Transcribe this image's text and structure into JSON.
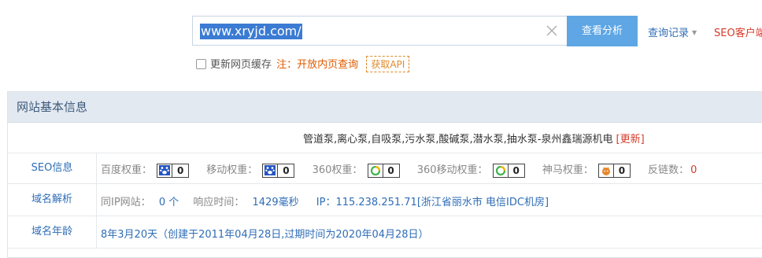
{
  "search": {
    "value": "www.xryjd.com/",
    "button": "查看分析"
  },
  "nav": {
    "history": "查询记录",
    "seo_client": "SEO客户端"
  },
  "cache": {
    "checkbox_label": "更新网页缓存",
    "note": "注：开放内页查询",
    "api_label": "获取API"
  },
  "panel": {
    "title": "网站基本信息",
    "site_title": "管道泵,离心泵,自吸泵,污水泵,酸碱泵,潜水泵,抽水泵-泉州鑫瑞源机电",
    "update_link": "[更新]",
    "seo": {
      "label": "SEO信息",
      "baidu_label": "百度权重：",
      "baidu_value": "0",
      "mobile_label": "移动权重：",
      "mobile_value": "0",
      "s360_label": "360权重：",
      "s360_value": "0",
      "s360_mobile_label": "360移动权重：",
      "s360_mobile_value": "0",
      "shenma_label": "神马权重：",
      "shenma_value": "0",
      "backlinks_label": "反链数：",
      "backlinks_value": "0"
    },
    "dns": {
      "label": "域名解析",
      "same_ip_label": "同IP网站：",
      "same_ip_value": "0 个",
      "response_label": "响应时间：",
      "response_value": "1429毫秒",
      "ip_text": "IP：115.238.251.71[浙江省丽水市 电信IDC机房]"
    },
    "age": {
      "label": "域名年龄",
      "value": "8年3月20天（创建于2011年04月28日,过期时间为2020年04月28日）"
    }
  },
  "colors": {
    "accent": "#5ea6e4",
    "link": "#2f6db6",
    "red": "#d73a2a",
    "orange": "#e08a2b",
    "header_bg": "#e3e9f1"
  }
}
